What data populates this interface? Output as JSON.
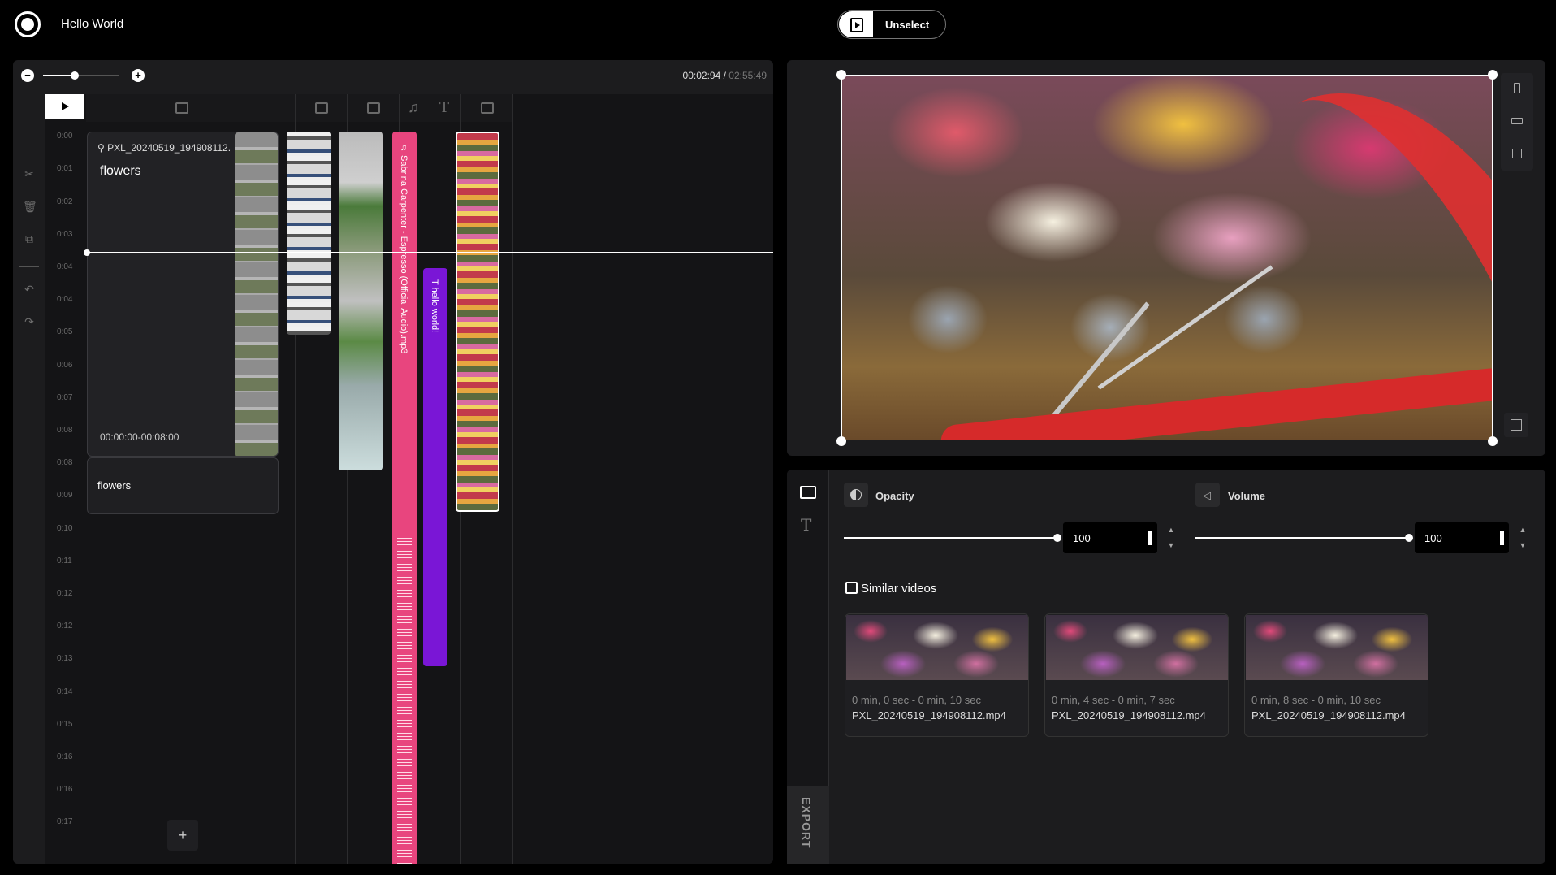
{
  "app": {
    "title": "Hello World"
  },
  "toolbar": {
    "unselect_label": "Unselect"
  },
  "timeline": {
    "zoom_minus": "−",
    "zoom_plus": "+",
    "zoom_level": 0.4,
    "current_time": "00:02:94",
    "separator": " / ",
    "total_time": "02:55:49",
    "ruler_ticks": [
      "0:00",
      "0:00",
      "0:01",
      "0:02",
      "0:03",
      "0:04",
      "0:04",
      "0:05",
      "0:06",
      "0:07",
      "0:08",
      "0:08",
      "0:09",
      "0:10",
      "0:11",
      "0:12",
      "0:12",
      "0:13",
      "0:14",
      "0:15",
      "0:16",
      "0:16",
      "0:17"
    ],
    "tools": [
      "scissors-icon",
      "trash-icon",
      "duplicate-icon",
      "undo-icon",
      "redo-icon"
    ],
    "track_headers": [
      "video-track-icon",
      "image-track-icon",
      "video-track-icon",
      "music-track-icon",
      "text-track-icon",
      "video-track-icon"
    ],
    "main_clip": {
      "filename": "PXL_20240519_194908112.",
      "title": "flowers",
      "range": "00:00:00-00:08:00"
    },
    "text_clip": {
      "label": "flowers"
    },
    "audio_clip": {
      "label": "♫ Sabrina Carpenter - Espresso (Official Audio).mp3"
    },
    "overlay_text_clip": {
      "label": "T  hello world!"
    },
    "add_track_label": "+"
  },
  "properties": {
    "opacity": {
      "label": "Opacity",
      "value": "100"
    },
    "volume": {
      "label": "Volume",
      "value": "100"
    },
    "export_label": "EXPORT",
    "similar_header": "Similar videos",
    "similar_videos": [
      {
        "range": "0 min, 0 sec - 0 min, 10 sec",
        "filename": "PXL_20240519_194908112.mp4"
      },
      {
        "range": "0 min, 4 sec - 0 min, 7 sec",
        "filename": "PXL_20240519_194908112.mp4"
      },
      {
        "range": "0 min, 8 sec - 0 min, 10 sec",
        "filename": "PXL_20240519_194908112.mp4"
      }
    ]
  },
  "colors": {
    "audio_clip": "#e8457e",
    "text_clip": "#7a16d6",
    "panel_bg": "#1c1c1e"
  }
}
